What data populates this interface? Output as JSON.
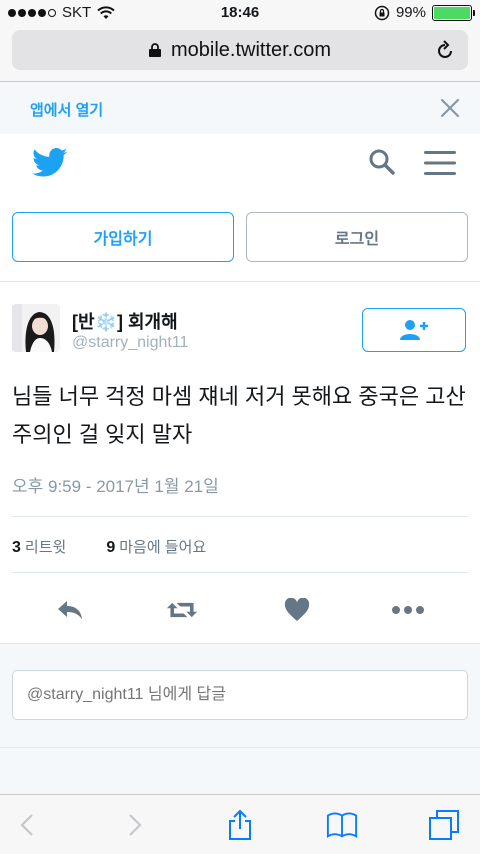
{
  "status": {
    "carrier": "SKT",
    "time": "18:46",
    "battery": "99%",
    "signal_bars": 4,
    "signal_total": 5,
    "battery_level": 0.99
  },
  "browser": {
    "url": "mobile.twitter.com"
  },
  "banner": {
    "open_in_app": "앱에서 열기"
  },
  "header": {
    "signup_label": "가입하기",
    "login_label": "로그인"
  },
  "tweet": {
    "display_name": "[반❄️] 회개해",
    "username": "@starry_night11",
    "text": "님들 너무 걱정 마셈 쟤네 저거 못해요 중국은 고산주의인 걸 잊지 말자",
    "timestamp": "오후 9:59 - 2017년 1월 21일",
    "retweets_count": "3",
    "retweets_label": "리트윗",
    "likes_count": "9",
    "likes_label": "마음에 들어요"
  },
  "reply": {
    "placeholder": "@starry_night11 님에게 답글"
  },
  "colors": {
    "accent": "#1da1f2",
    "muted": "#657786",
    "battery": "#4cd964"
  }
}
